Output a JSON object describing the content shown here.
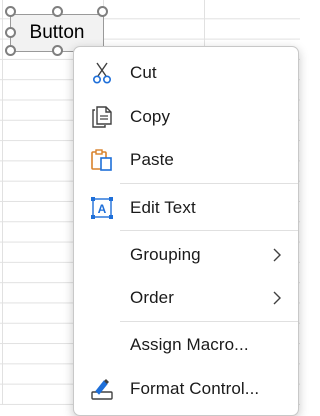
{
  "sheet": {
    "button_label": "Button"
  },
  "context_menu": {
    "items": [
      {
        "label": "Cut",
        "icon": "scissors-icon"
      },
      {
        "label": "Copy",
        "icon": "copy-icon"
      },
      {
        "label": "Paste",
        "icon": "paste-icon"
      },
      {
        "label": "Edit Text",
        "icon": "edit-text-icon"
      },
      {
        "label": "Grouping",
        "icon": "",
        "submenu": true
      },
      {
        "label": "Order",
        "icon": "",
        "submenu": true
      },
      {
        "label": "Assign Macro...",
        "icon": ""
      },
      {
        "label": "Format Control...",
        "icon": "format-control-icon"
      }
    ]
  },
  "colors": {
    "accent_blue": "#1e6fd9",
    "paste_orange": "#d9822b",
    "text": "#1a1a1a"
  }
}
